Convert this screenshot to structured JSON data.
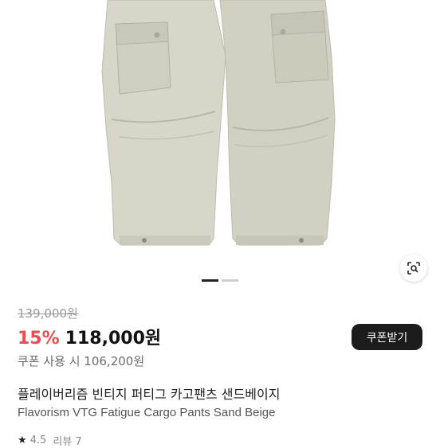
{
  "product": {
    "image_alt": "Sand beige cargo pants",
    "original_price": "139,000원",
    "discount": "15%",
    "sale_price": "118,000원",
    "coupon_button_label": "쿠폰받기",
    "coupon_price": "쿠폰 사용 시 106,200원",
    "title_ko": "플레이버리즘 빈티지 퍼티그 카고팬츠 샌드베이지",
    "title_en": "Flavorism VTG Fatigue Cargo Pants Sand Beige",
    "rating": "4.5",
    "review_label": "리뷰 7"
  },
  "carousel": {
    "count": 2,
    "active_index": 0
  },
  "icons": {
    "lens": "lens-search-icon",
    "star": "star-icon"
  },
  "colors": {
    "pants": "#d7d6c9",
    "discount": "#ef4b4b",
    "button_bg": "#1c1c1c"
  }
}
